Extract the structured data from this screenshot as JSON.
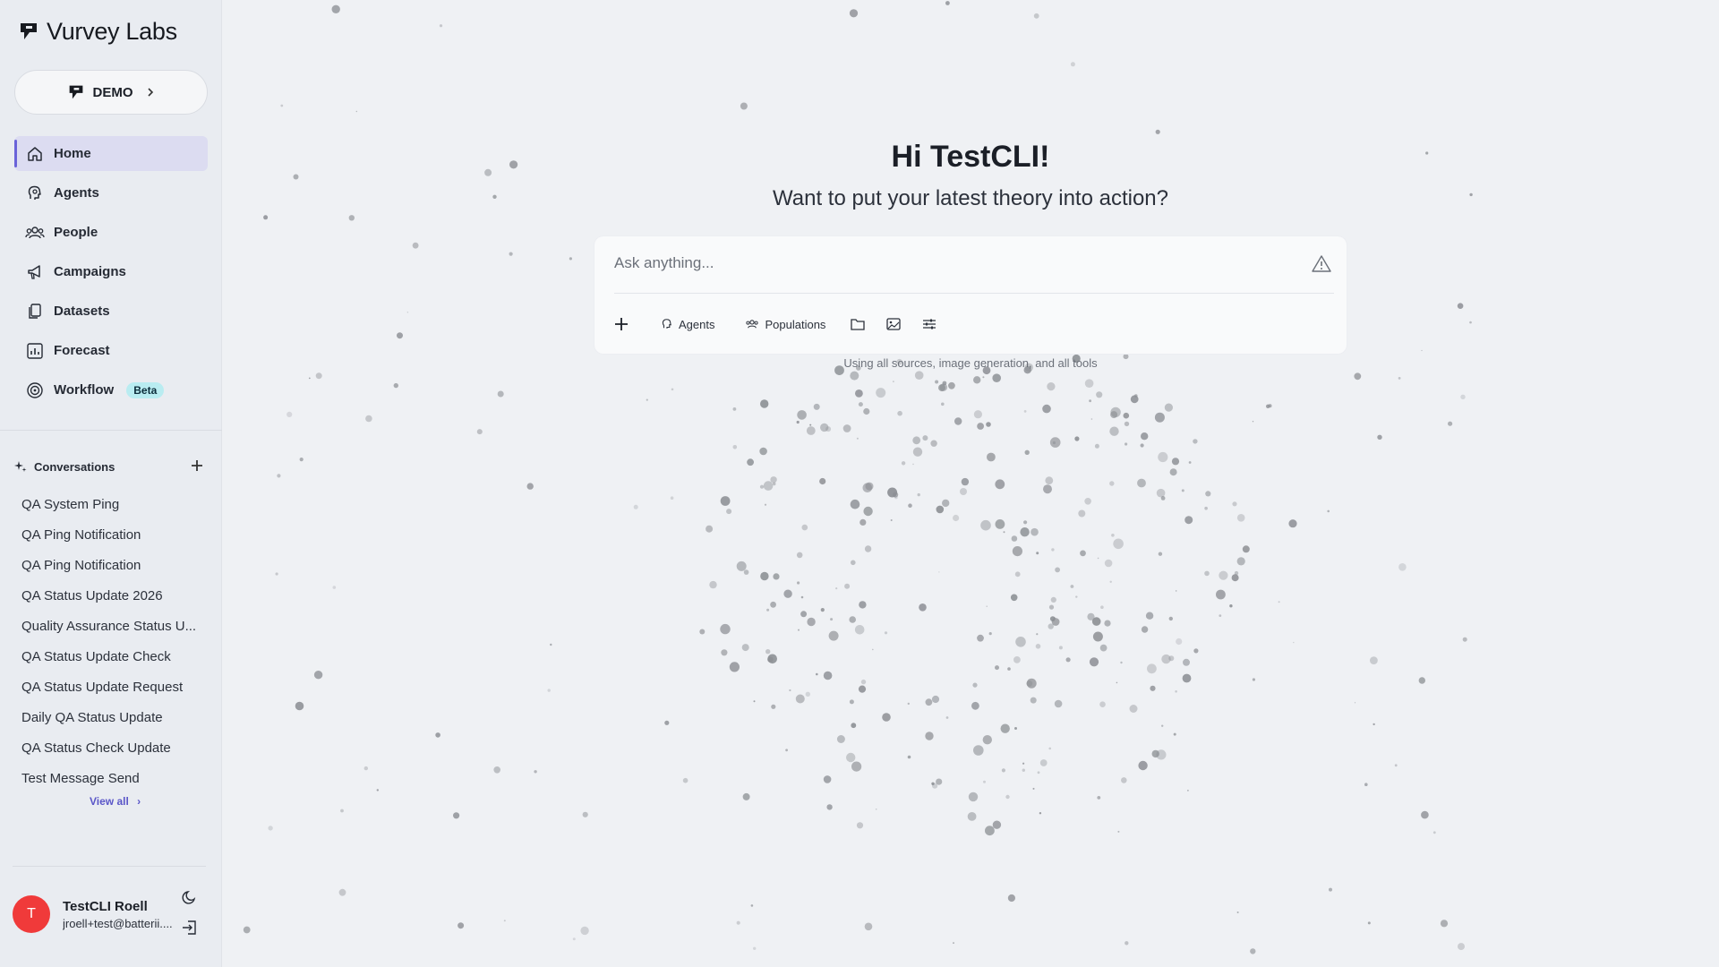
{
  "brand": {
    "name": "Vurvey Labs"
  },
  "workspace": {
    "label": "DEMO"
  },
  "nav": [
    {
      "label": "Home",
      "icon": "home-icon",
      "active": true
    },
    {
      "label": "Agents",
      "icon": "agents-icon"
    },
    {
      "label": "People",
      "icon": "people-icon"
    },
    {
      "label": "Campaigns",
      "icon": "megaphone-icon"
    },
    {
      "label": "Datasets",
      "icon": "datasets-icon"
    },
    {
      "label": "Forecast",
      "icon": "forecast-icon"
    },
    {
      "label": "Workflow",
      "icon": "workflow-icon",
      "badge": "Beta"
    }
  ],
  "conversations": {
    "title": "Conversations",
    "items": [
      "QA System Ping",
      "QA Ping Notification",
      "QA Ping Notification",
      "QA Status Update 2026",
      "Quality Assurance Status U...",
      "QA Status Update Check",
      "QA Status Update Request",
      "Daily QA Status Update",
      "QA Status Check Update",
      "Test Message Send"
    ],
    "view_all": "View all"
  },
  "user": {
    "initial": "T",
    "name": "TestCLI Roell",
    "email": "jroell+test@batterii...."
  },
  "main": {
    "greeting": "Hi TestCLI!",
    "subtitle": "Want to put your latest theory into action?",
    "input_placeholder": "Ask anything...",
    "tools": {
      "agents": "Agents",
      "populations": "Populations"
    },
    "hint": "Using all sources, image generation, and all tools"
  },
  "colors": {
    "accent": "#6a63d9",
    "avatar": "#f03a3a",
    "badge": "#b9ecf1"
  }
}
